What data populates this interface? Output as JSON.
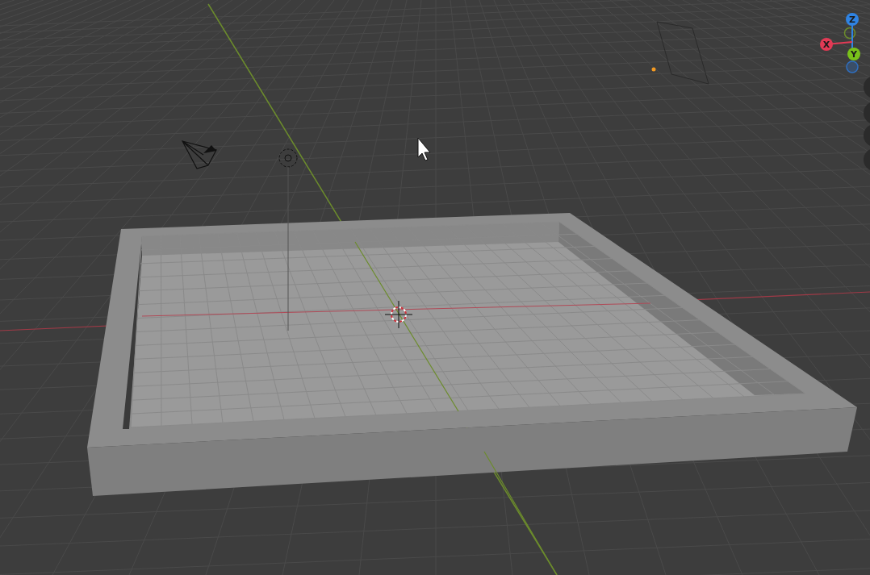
{
  "viewport": {
    "gizmo": {
      "axes": [
        {
          "label": "Z",
          "color": "#2f83e3"
        },
        {
          "label": "X",
          "color": "#e23a55"
        },
        {
          "label": "Y",
          "color": "#79c21a"
        }
      ]
    }
  }
}
